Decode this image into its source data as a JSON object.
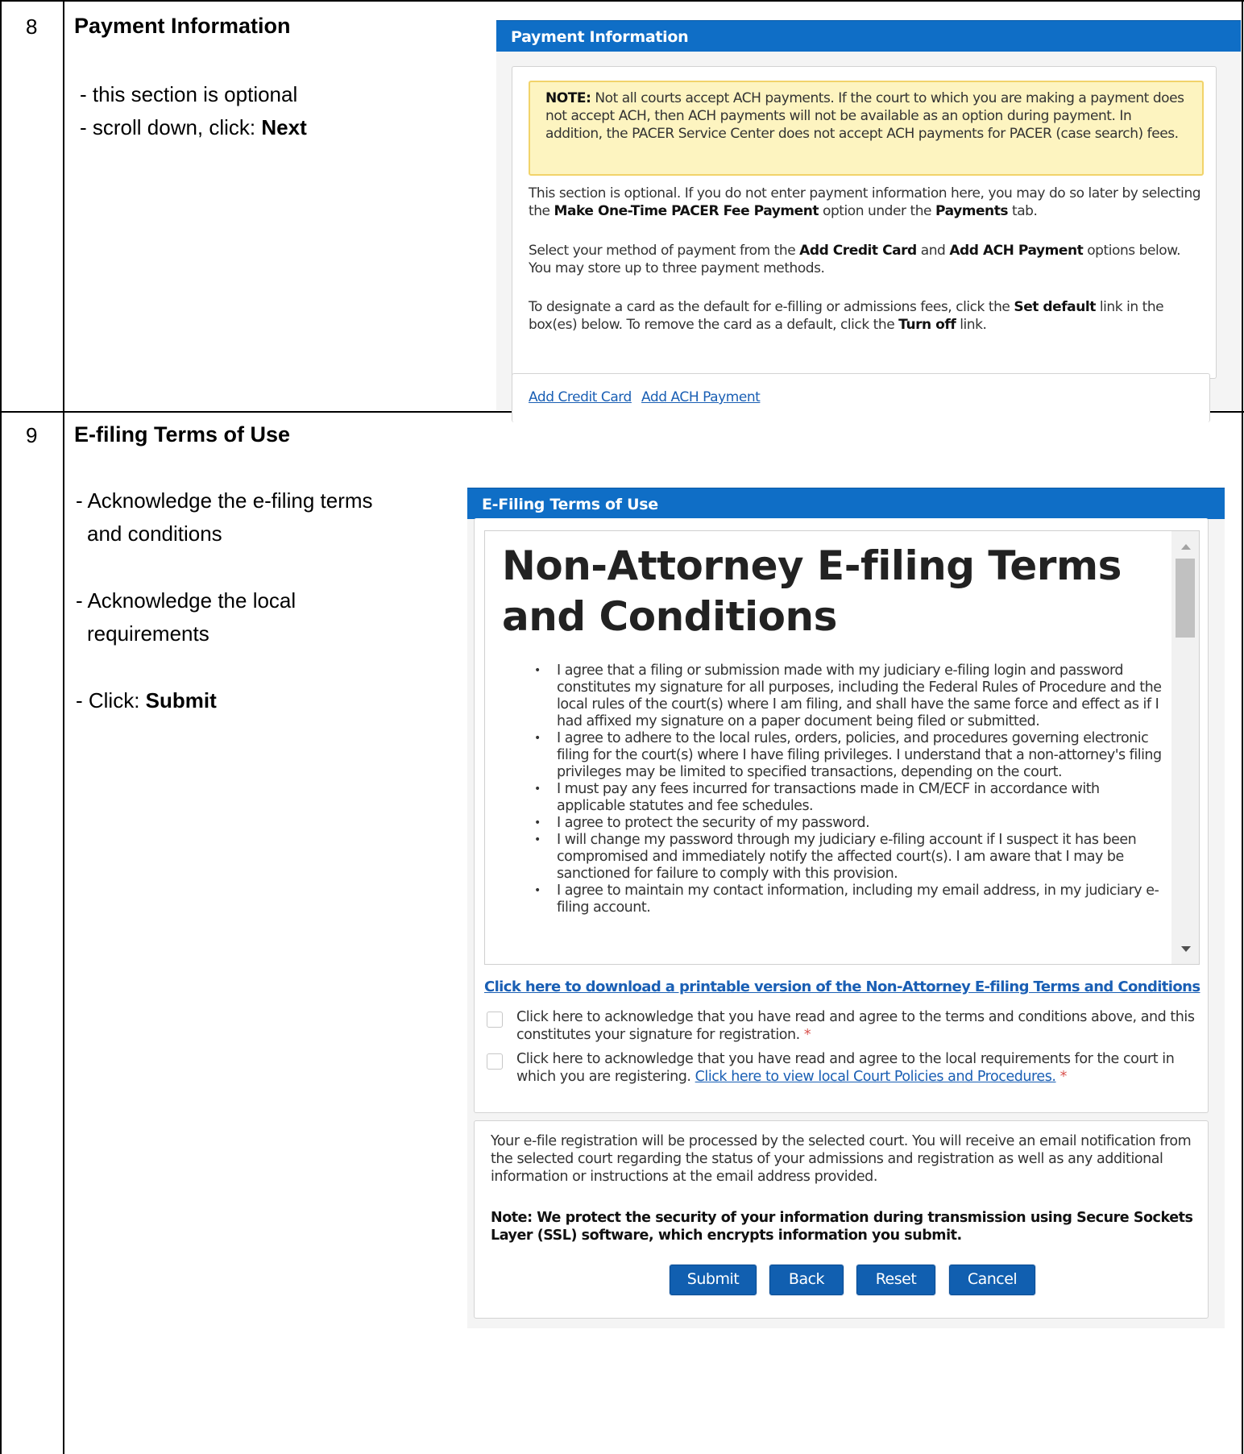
{
  "steps": [
    {
      "number": "8",
      "title": "Payment Information",
      "instructions": [
        "- this section is optional",
        "- scroll down, click: "
      ],
      "instruction_bold": "Next"
    },
    {
      "number": "9",
      "title": "E-filing Terms of Use",
      "instructions": [
        "- Acknowledge the e-filing terms",
        "and conditions",
        "- Acknowledge the local",
        "requirements",
        "- Click: "
      ],
      "instruction_bold": "Submit"
    }
  ],
  "payment_panel": {
    "header": "Payment Information",
    "note_label": "NOTE:",
    "note_text": " Not all courts accept ACH payments. If the court to which you are making a payment does not accept ACH, then ACH payments will not be available as an option during payment. In addition, the PACER Service Center does not accept ACH payments for PACER (case search) fees.",
    "p1_a": "This section is optional. If you do not enter payment information here, you may do so later by selecting the ",
    "p1_b": "Make One-Time PACER Fee Payment",
    "p1_c": " option under the ",
    "p1_d": "Payments",
    "p1_e": " tab.",
    "p2_a": "Select your method of payment from the ",
    "p2_b": "Add Credit Card",
    "p2_c": " and ",
    "p2_d": "Add ACH Payment",
    "p2_e": " options below. You may store up to three payment methods.",
    "p3_a": "To designate a card as the default for e-filling or admissions fees, click the ",
    "p3_b": "Set default",
    "p3_c": " link in the box(es) below. To remove the card as a default, click the ",
    "p3_d": "Turn off",
    "p3_e": " link.",
    "add_credit_card": "Add Credit Card",
    "add_ach_payment": "Add ACH Payment"
  },
  "terms_panel": {
    "header": "E-Filing Terms of Use",
    "heading": "Non-Attorney E-filing Terms and Conditions",
    "items": [
      "I agree that a filing or submission made with my judiciary e-filing login and password constitutes my signature for all purposes, including the Federal Rules of Procedure and the local rules of the court(s) where I am filing, and shall have the same force and effect as if I had affixed my signature on a paper document being filed or submitted.",
      "I agree to adhere to the local rules, orders, policies, and procedures governing electronic filing for the court(s) where I have filing privileges. I understand that a non-attorney's filing privileges may be limited to specified transactions, depending on the court.",
      "I must pay any fees incurred for transactions made in CM/ECF in accordance with applicable statutes and fee schedules.",
      "I agree to protect the security of my password.",
      "I will change my password through my judiciary e-filing account if I suspect it has been compromised and immediately notify the affected court(s). I am aware that I may be sanctioned for failure to comply with this provision.",
      "I agree to maintain my contact information, including my email address, in my judiciary e-filing account."
    ],
    "download_link": "Click here to download a printable version of the Non-Attorney E-filing Terms and Conditions",
    "ack1": "Click here to acknowledge that you have read and agree to the terms and conditions above, and this constitutes your signature for registration.",
    "ack2_a": "Click here to acknowledge that you have read and agree to the local requirements for the court in which you are registering. ",
    "ack2_link": "Click here to view local Court Policies and Procedures.",
    "required_mark": "*",
    "processing_text": "Your e-file registration will be processed by the selected court. You will receive an email notification from the selected court regarding the status of your admissions and registration as well as any additional information or instructions at the email address provided.",
    "security_note": "Note: We protect the security of your information during transmission using Secure Sockets Layer (SSL) software, which encrypts information you submit.",
    "buttons": {
      "submit": "Submit",
      "back": "Back",
      "reset": "Reset",
      "cancel": "Cancel"
    }
  },
  "colors": {
    "header_blue": "#0f6ec6",
    "button_blue": "#115fb0",
    "note_bg": "#fdf4c0",
    "link": "#1a5fb4",
    "required": "#d9534f"
  }
}
